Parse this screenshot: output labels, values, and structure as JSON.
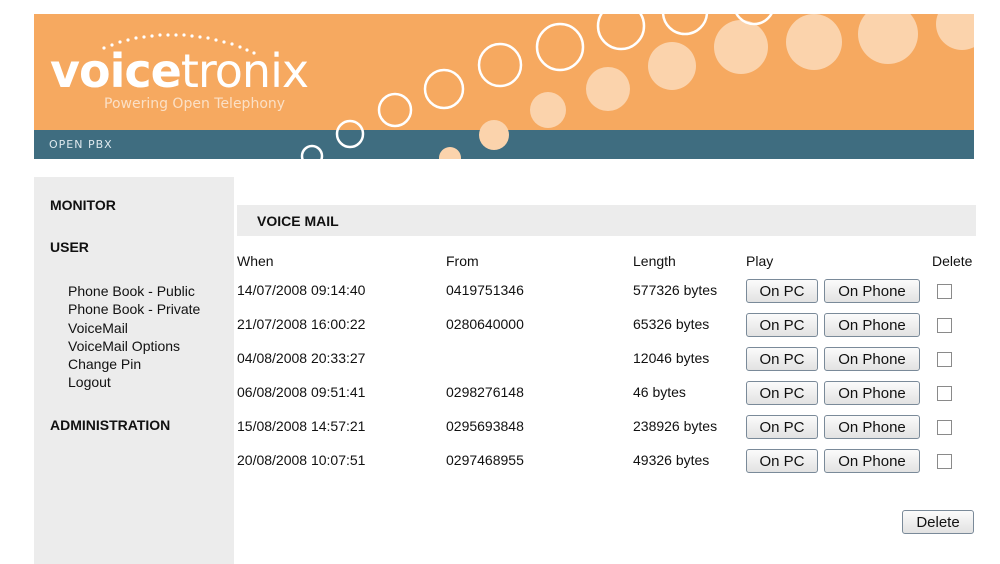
{
  "brand": {
    "logo_bold": "voice",
    "logo_light": "tronix",
    "tagline": "Powering Open Telephony",
    "strip_label": "OPEN PBX",
    "colors": {
      "banner": "#f6a960",
      "strip": "#3f6d80"
    }
  },
  "sidebar": {
    "monitor": "MONITOR",
    "user": "USER",
    "administration": "ADMINISTRATION",
    "user_links": [
      "Phone Book - Public",
      "Phone Book - Private",
      "VoiceMail",
      "VoiceMail Options",
      "Change Pin",
      "Logout"
    ]
  },
  "voicemail": {
    "title": "VOICE MAIL",
    "columns": {
      "when": "When",
      "from": "From",
      "length": "Length",
      "play": "Play",
      "delete": "Delete"
    },
    "play_pc_label": "On PC",
    "play_phone_label": "On Phone",
    "delete_label": "Delete",
    "rows": [
      {
        "when": "14/07/2008 09:14:40",
        "from": "0419751346",
        "length": "577326 bytes",
        "checked": false
      },
      {
        "when": "21/07/2008 16:00:22",
        "from": "0280640000",
        "length": "65326 bytes",
        "checked": false
      },
      {
        "when": "04/08/2008 20:33:27",
        "from": "",
        "length": "12046 bytes",
        "checked": false
      },
      {
        "when": "06/08/2008 09:51:41",
        "from": "0298276148",
        "length": "46 bytes",
        "checked": false
      },
      {
        "when": "15/08/2008 14:57:21",
        "from": "0295693848",
        "length": "238926 bytes",
        "checked": false
      },
      {
        "when": "20/08/2008 10:07:51",
        "from": "0297468955",
        "length": "49326 bytes",
        "checked": false
      }
    ]
  }
}
